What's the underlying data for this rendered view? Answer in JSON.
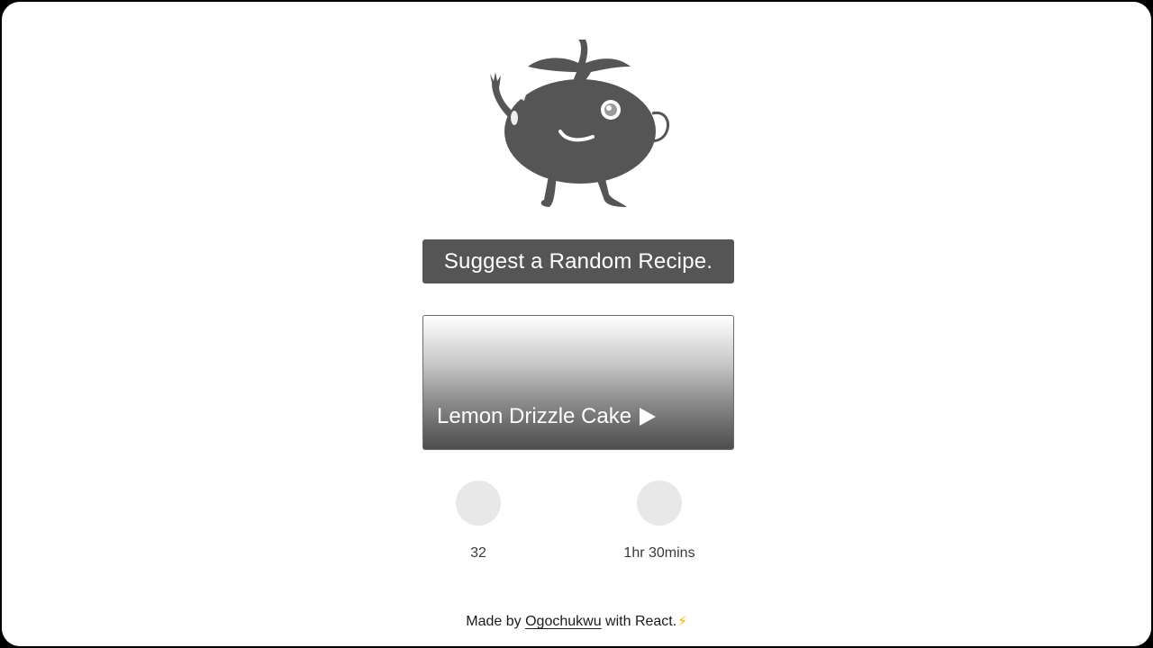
{
  "app": {
    "suggest_button_label": "Suggest a Random Recipe."
  },
  "recipe": {
    "title": "Lemon Drizzle Cake",
    "play_icon": "play-triangle-icon"
  },
  "stats": [
    {
      "icon": "stat-placeholder-icon",
      "value": "32"
    },
    {
      "icon": "stat-placeholder-icon",
      "value": "1hr 30mins"
    }
  ],
  "footer": {
    "prefix": "Made by",
    "author": "Ogochukwu",
    "suffix": "with React.",
    "emoji": "⚡"
  },
  "colors": {
    "mascot": "#555555",
    "button_bg": "#555555",
    "bolt": "#f5b400",
    "stat_circle": "#e8e8e8"
  }
}
